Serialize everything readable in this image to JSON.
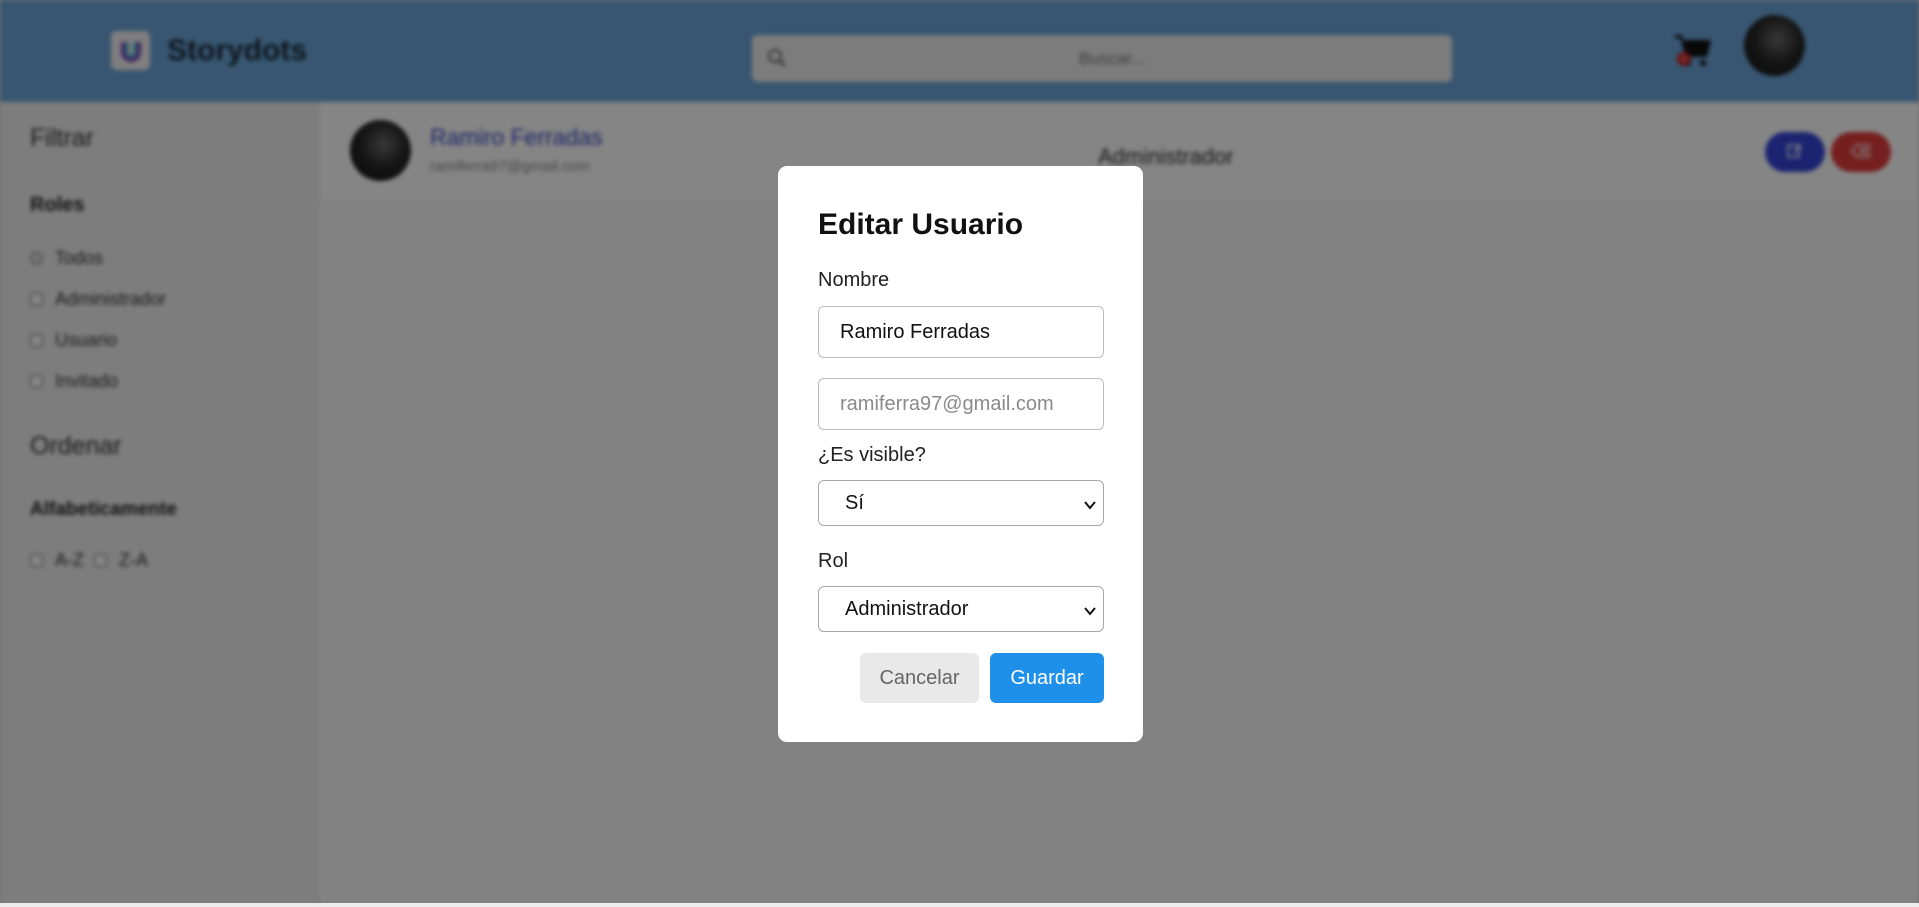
{
  "header": {
    "brand": "Storydots",
    "search_placeholder": "Buscar...",
    "cart_count": "0"
  },
  "sidebar": {
    "filter_title": "Filtrar",
    "roles_title": "Roles",
    "roles": [
      "Todos",
      "Administrador",
      "Usuario",
      "Invitado"
    ],
    "sort_title": "Ordenar",
    "alpha_title": "Alfabeticamente",
    "alpha_options": [
      "A-Z",
      "Z-A"
    ]
  },
  "user_row": {
    "name": "Ramiro Ferradas",
    "email": "ramiferra97@gmail.com",
    "role": "Administrador"
  },
  "modal": {
    "title": "Editar Usuario",
    "name_label": "Nombre",
    "name_value": "Ramiro Ferradas",
    "email_placeholder": "ramiferra97@gmail.com",
    "visible_label": "¿Es visible?",
    "visible_value": "Sí",
    "role_label": "Rol",
    "role_value": "Administrador",
    "cancel_label": "Cancelar",
    "save_label": "Guardar"
  },
  "colors": {
    "topbar": "#6ca6d9",
    "primary": "#1e90ea",
    "edit": "#3545d8",
    "delete": "#e23d3d"
  }
}
